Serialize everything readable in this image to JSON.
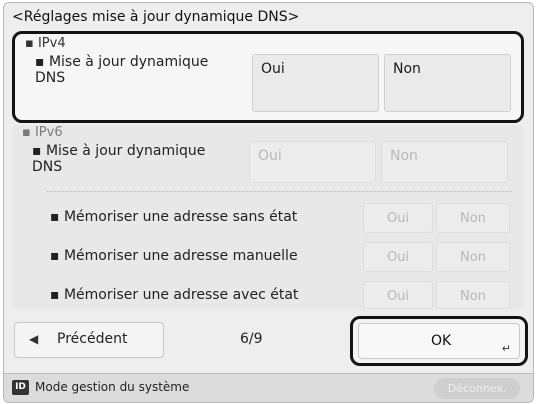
{
  "title": "<Réglages mise à jour dynamique DNS>",
  "ipv4": {
    "header": "IPv4",
    "ddns_label": "Mise à jour dynamique DNS",
    "yes": "Oui",
    "no": "Non"
  },
  "ipv6": {
    "header": "IPv6",
    "ddns_label": "Mise à jour dynamique DNS",
    "yes": "Oui",
    "no": "Non",
    "stateless_label": "Mémoriser une adresse sans état",
    "manual_label": "Mémoriser une adresse manuelle",
    "stateful_label": "Mémoriser une adresse avec état"
  },
  "nav": {
    "prev_label": "Précédent",
    "page": "6/9",
    "ok_label": "OK"
  },
  "status": {
    "id_icon": "ID",
    "mode_text": "Mode gestion du système",
    "logout_label": "Déconnex."
  },
  "icons": {
    "prev": "left-triangle-icon",
    "ok_enter": "enter-return-icon",
    "bullet": "square-bullet-icon"
  }
}
